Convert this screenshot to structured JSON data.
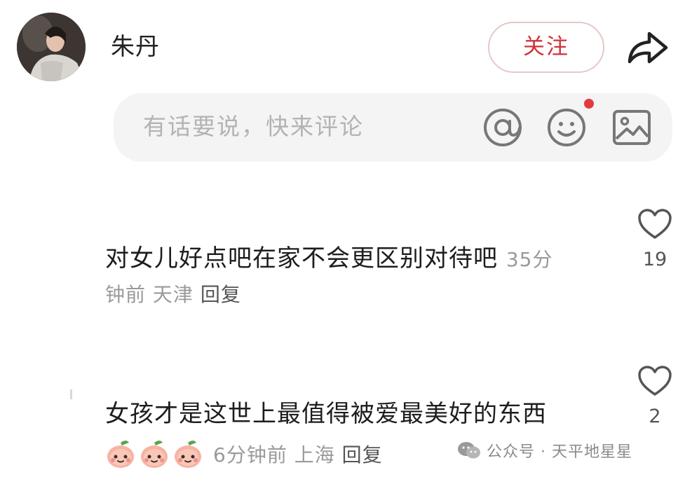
{
  "header": {
    "author_name": "朱丹",
    "follow_label": "关注"
  },
  "comment_bar": {
    "placeholder": "有话要说，快来评论"
  },
  "comments": [
    {
      "text": "对女儿好点吧在家不会更区别对待吧",
      "time_inline": "35分",
      "time_rest": "钟前",
      "location": "天津",
      "reply_label": "回复",
      "likes": "19"
    },
    {
      "text": "女孩才是这世上最值得被爱最美好的东西",
      "emoji_count": 3,
      "time": "6分钟前",
      "location": "上海",
      "reply_label": "回复",
      "likes": "2"
    }
  ],
  "watermark": {
    "text": "公众号 · 天平地星星"
  },
  "colors": {
    "accent": "#d0323a",
    "notification_dot": "#e33a3f",
    "bar_background": "#f4f4f4"
  },
  "icons": [
    "share-icon",
    "at-icon",
    "emoji-icon",
    "image-icon",
    "heart-icon",
    "peach-emoji",
    "wechat-icon"
  ]
}
